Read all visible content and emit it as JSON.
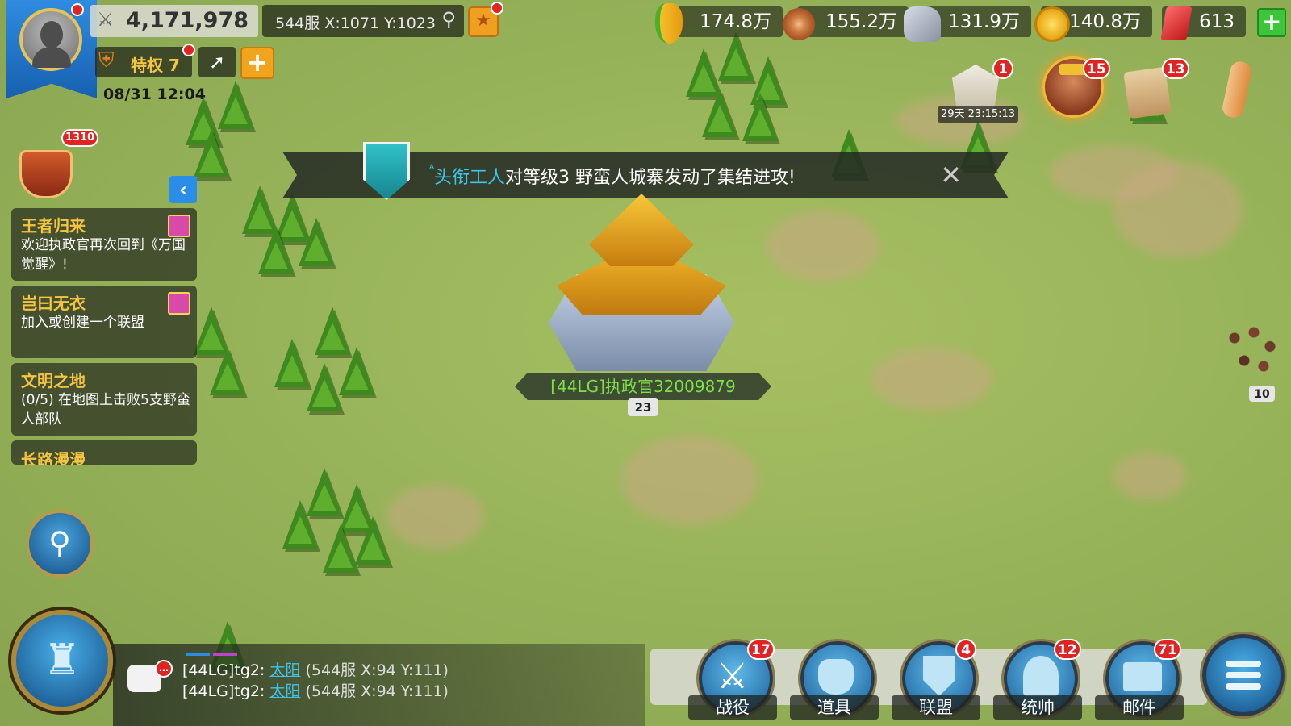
{
  "player": {
    "power": "4,171,978",
    "coords": "544服 X:1071 Y:1023",
    "vip_label": "特权 7",
    "datetime": "08/31 12:04"
  },
  "resources": {
    "food": "174.8万",
    "wood": "155.2万",
    "stone": "131.9万",
    "gold": "140.8万",
    "gems": "613"
  },
  "events": {
    "event1_badge": "1",
    "event1_timer": "29天 23:15:13",
    "event2_badge": "15",
    "event3_badge": "13"
  },
  "missions_badge": "1310",
  "notification": {
    "player_name": "头衔工人",
    "player_prefix": "ᴬ",
    "message": "对等级3 野蛮人城寨发动了集结进攻!"
  },
  "quests": [
    {
      "title": "王者归来",
      "desc": "欢迎执政官再次回到《万国觉醒》!"
    },
    {
      "title": "岂曰无衣",
      "desc": "加入或创建一个联盟"
    },
    {
      "title": "文明之地",
      "desc": "(0/5) 在地图上击败5支野蛮人部队"
    },
    {
      "title": "长路漫漫",
      "desc": ""
    }
  ],
  "city": {
    "name": "[44LG]执政官32009879",
    "level": "23"
  },
  "barbarian_level": "10",
  "chat": [
    {
      "sender": "[44LG]tg2",
      "link": "太阳",
      "rest": "(544服 X:94 Y:111)"
    },
    {
      "sender": "[44LG]tg2",
      "link": "太阳",
      "rest": "(544服 X:94 Y:111)"
    }
  ],
  "nav": [
    {
      "label": "战役",
      "badge": "17"
    },
    {
      "label": "道具",
      "badge": ""
    },
    {
      "label": "联盟",
      "badge": "4"
    },
    {
      "label": "统帅",
      "badge": "12"
    },
    {
      "label": "邮件",
      "badge": "71"
    }
  ],
  "colors": {
    "accent_yellow": "#f5c542",
    "badge_red": "#e02424",
    "link_cyan": "#3cc6f0",
    "city_name_green": "#7ee04a"
  }
}
